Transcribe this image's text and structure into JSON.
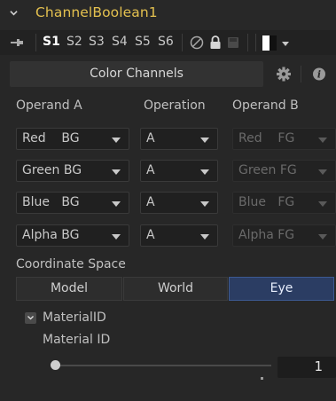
{
  "header": {
    "title": "ChannelBoolean1"
  },
  "toolbar": {
    "slots": [
      "S1",
      "S2",
      "S3",
      "S4",
      "S5",
      "S6"
    ],
    "active_slot": "S1"
  },
  "tabs": {
    "main_label": "Color Channels"
  },
  "columns": {
    "a": "Operand A",
    "op": "Operation",
    "b": "Operand B"
  },
  "rows": [
    {
      "operand_a": "Red    BG",
      "operation": "A",
      "operand_b": "Red    FG"
    },
    {
      "operand_a": "Green BG",
      "operation": "A",
      "operand_b": "Green FG"
    },
    {
      "operand_a": "Blue   BG",
      "operation": "A",
      "operand_b": "Blue   FG"
    },
    {
      "operand_a": "Alpha BG",
      "operation": "A",
      "operand_b": "Alpha FG"
    }
  ],
  "coordinate": {
    "label": "Coordinate Space",
    "options": [
      "Model",
      "World",
      "Eye"
    ],
    "selected": "Eye"
  },
  "material": {
    "toggle_label": "MaterialID",
    "field_label": "Material ID",
    "value": "1"
  },
  "colors": {
    "title": "#e3c04f",
    "selected": "#2b3d63",
    "background": "#272727"
  }
}
